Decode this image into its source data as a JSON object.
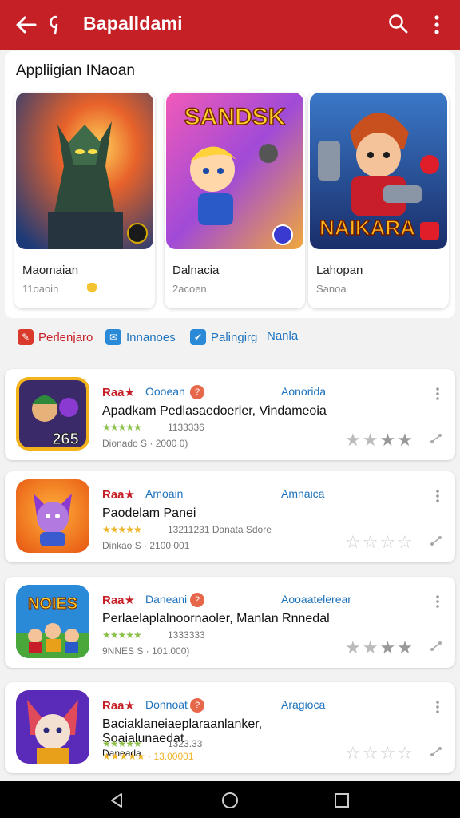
{
  "appbar": {
    "title": "Bapalldami",
    "icons": [
      "back-arrow-icon",
      "logo-icon",
      "search-icon",
      "more-vert-icon"
    ]
  },
  "featured": {
    "heading": "Appliigian INaoan",
    "cards": [
      {
        "name": "Maomaian",
        "sub": "11oaoin",
        "art_text": ""
      },
      {
        "name": "Dalnacia",
        "sub": "2acoen",
        "art_text": "SANDSK"
      },
      {
        "name": "Lahopan",
        "sub": "Sanoa",
        "art_text": "NAIKARA"
      }
    ]
  },
  "tabs": [
    {
      "label": "Perlenjaro",
      "color": "#d93a2b"
    },
    {
      "label": "Innanoes",
      "color": "#2a8ad8"
    },
    {
      "label": "Palingirg",
      "color": "#2a8ad8"
    },
    {
      "label": "Nanla",
      "color": "#2a8ad8"
    }
  ],
  "list": [
    {
      "brand": "Raa★",
      "dev": "Oooean",
      "badge": "?",
      "category": "Aonorida",
      "desc": "Apadkam Pedlasaedoerler, Vindameoia",
      "stars": "★★★★★",
      "meta1": "1133336",
      "meta2": "Dionado S · 2000 0)",
      "icon_text": "265",
      "rating": 4
    },
    {
      "brand": "Raa★",
      "dev": "Amoain",
      "badge": "",
      "category": "Amnaica",
      "desc": "Paodelam Panei",
      "stars": "★★★★★",
      "meta1": "13211231  Danata Sdore",
      "meta2": "Dinkao S · 2100 001",
      "icon_text": "",
      "rating": 0
    },
    {
      "brand": "Raa★",
      "dev": "Daneani",
      "badge": "?",
      "category": "Aooaatelerear",
      "desc": "Perlaelaplalnoornaoler, Manlan Rnnedal",
      "stars": "★★★★★",
      "meta1": "1333333",
      "meta2": "9NNES S · 101.000)",
      "icon_text": "NOIES",
      "rating": 4
    },
    {
      "brand": "Raa★",
      "dev": "Donnoat",
      "badge": "?",
      "category": "Aragioca",
      "desc": "Baciaklaneiaeplaraanlanker, Soaialunaedat",
      "desc2": "Daneada",
      "stars": "★★★★★",
      "meta1": "1323.33",
      "meta2": "★★★★★ · 13.00001",
      "icon_text": "",
      "rating": 0
    }
  ],
  "navbar": {
    "icons": [
      "nav-back-icon",
      "nav-home-icon",
      "nav-recents-icon"
    ]
  },
  "colors": {
    "primary": "#c62027",
    "link": "#1e73be",
    "star": "#8cbf4a",
    "star_gold": "#f0b429"
  }
}
